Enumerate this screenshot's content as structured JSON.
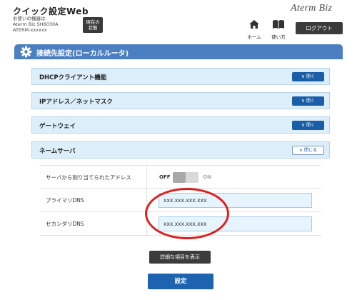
{
  "header": {
    "app_title": "クイック設定Web",
    "device_line1": "お使いの機器は",
    "device_line2": "Aterm Biz SH6030A",
    "device_line3": "ATERM-xxxxxx",
    "status_button_line1": "現在の",
    "status_button_line2": "状態",
    "logo": "Aterm Biz",
    "home_label": "ホーム",
    "manual_label": "使い方",
    "logout_label": "ログアウト"
  },
  "section": {
    "title": "接続先設定(ローカルルータ)"
  },
  "accordions": [
    {
      "label": "DHCPクライアント機能",
      "button": "開く",
      "state": "collapsed"
    },
    {
      "label": "IPアドレス／ネットマスク",
      "button": "開く",
      "state": "collapsed"
    },
    {
      "label": "ゲートウェイ",
      "button": "開く",
      "state": "collapsed"
    },
    {
      "label": "ネームサーバ",
      "button": "閉じる",
      "state": "expanded"
    }
  ],
  "name_server": {
    "auto_label": "サーバから割り当てられたアドレス",
    "toggle_off": "OFF",
    "toggle_on": "ON",
    "toggle_state": "off",
    "primary_label": "プライマリDNS",
    "primary_value": "xxx.xxx.xxx.xxx",
    "secondary_label": "セカンダリDNS",
    "secondary_value": "xxx.xxx.xxx.xxx"
  },
  "buttons": {
    "detail": "詳細な項目を表示",
    "submit": "設定"
  },
  "colors": {
    "section_header": "#4a7fc1",
    "accordion_bg": "#dceefa",
    "primary_button": "#1e63b0",
    "annotation": "#e21d1d"
  },
  "icons": [
    "gear-icon",
    "home-icon",
    "book-icon",
    "chevron-down-icon",
    "chevron-up-icon"
  ]
}
